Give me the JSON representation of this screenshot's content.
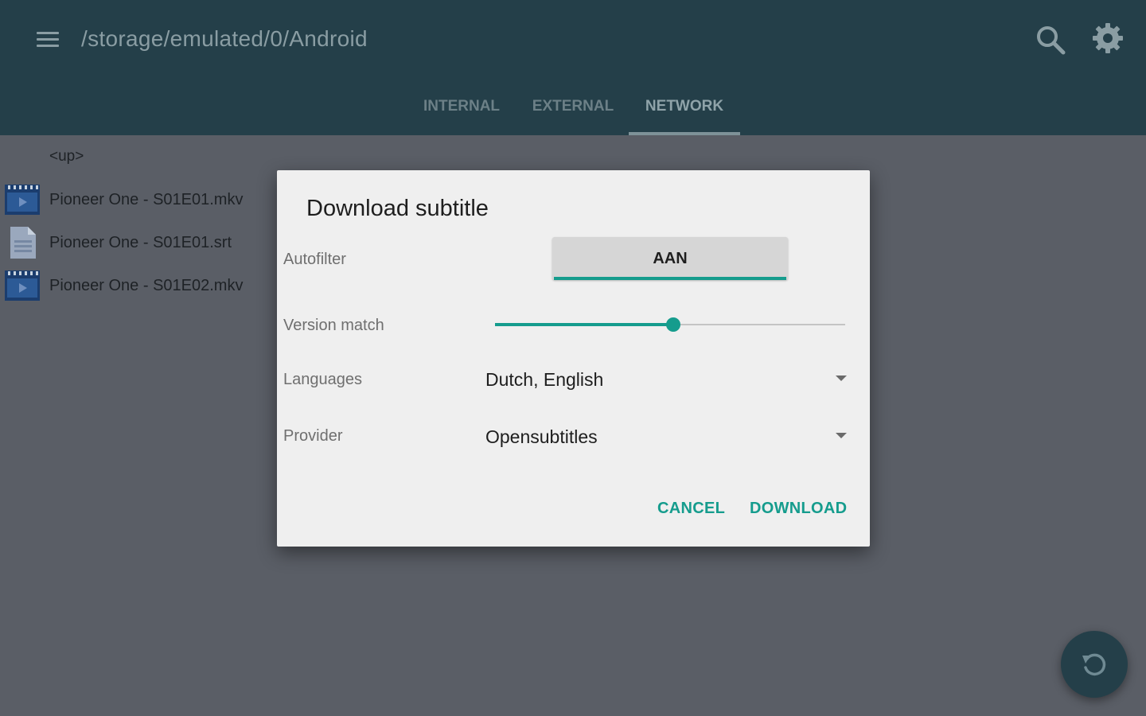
{
  "appbar": {
    "path": "/storage/emulated/0/Android",
    "icons": [
      "menu-icon",
      "search-icon",
      "gear-icon"
    ],
    "background": "#243f49"
  },
  "tabs": [
    {
      "label": "INTERNAL",
      "active": false
    },
    {
      "label": "EXTERNAL",
      "active": false
    },
    {
      "label": "NETWORK",
      "active": true
    }
  ],
  "files": {
    "up_label": "<up>",
    "items": [
      {
        "name": "Pioneer One - S01E01.mkv",
        "icon": "video-file-icon"
      },
      {
        "name": "Pioneer One - S01E01.srt",
        "icon": "document-file-icon"
      },
      {
        "name": "Pioneer One - S01E02.mkv",
        "icon": "video-file-icon"
      }
    ]
  },
  "dialog": {
    "title": "Download subtitle",
    "autofilter": {
      "label": "Autofilter",
      "value": "AAN"
    },
    "version_match": {
      "label": "Version match",
      "level": 0.51
    },
    "languages": {
      "label": "Languages",
      "value": "Dutch, English"
    },
    "provider": {
      "label": "Provider",
      "value": "Opensubtitles"
    },
    "cancel_label": "CANCEL",
    "download_label": "DOWNLOAD",
    "accent": "#159c8d"
  },
  "fab": {
    "icon": "refresh-icon"
  }
}
